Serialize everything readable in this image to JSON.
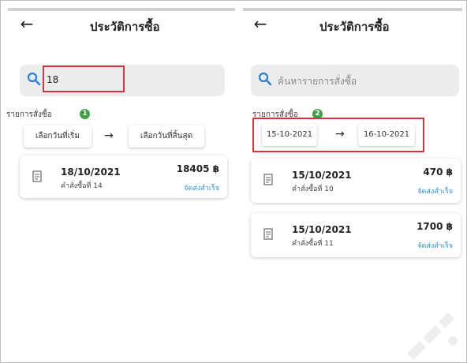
{
  "left": {
    "title": "ประวัติการซื้อ",
    "search_value": "18",
    "orders_label": "รายการสั่งซื้อ",
    "count": "1",
    "start_date_label": "เลือกวันที่เริ่ม",
    "end_date_label": "เลือกวันที่สิ้นสุด",
    "orders": [
      {
        "date": "18/10/2021",
        "number": "คำสั่งซื้อที่ 14",
        "amount": "18405 ฿",
        "status": "จัดส่งสำเร็จ"
      }
    ]
  },
  "right": {
    "title": "ประวัติการซื้อ",
    "search_placeholder": "ค้นหารายการสั่งซื้อ",
    "orders_label": "รายการสั่งซื้อ",
    "count": "2",
    "start_date": "15-10-2021",
    "end_date": "16-10-2021",
    "orders": [
      {
        "date": "15/10/2021",
        "number": "คำสั่งซื้อที่ 10",
        "amount": "470 ฿",
        "status": "จัดส่งสำเร็จ"
      },
      {
        "date": "15/10/2021",
        "number": "คำสั่งซื้อที่ 11",
        "amount": "1700 ฿",
        "status": "จัดส่งสำเร็จ"
      }
    ]
  },
  "icons": {
    "back": "arrow-left-icon",
    "search": "search-icon",
    "receipt": "receipt-icon",
    "date_arrow": "arrow-right-icon"
  },
  "colors": {
    "highlight": "#d8323c",
    "badge": "#43a047",
    "status": "#2a8fd8",
    "search_bg": "#ececef"
  }
}
